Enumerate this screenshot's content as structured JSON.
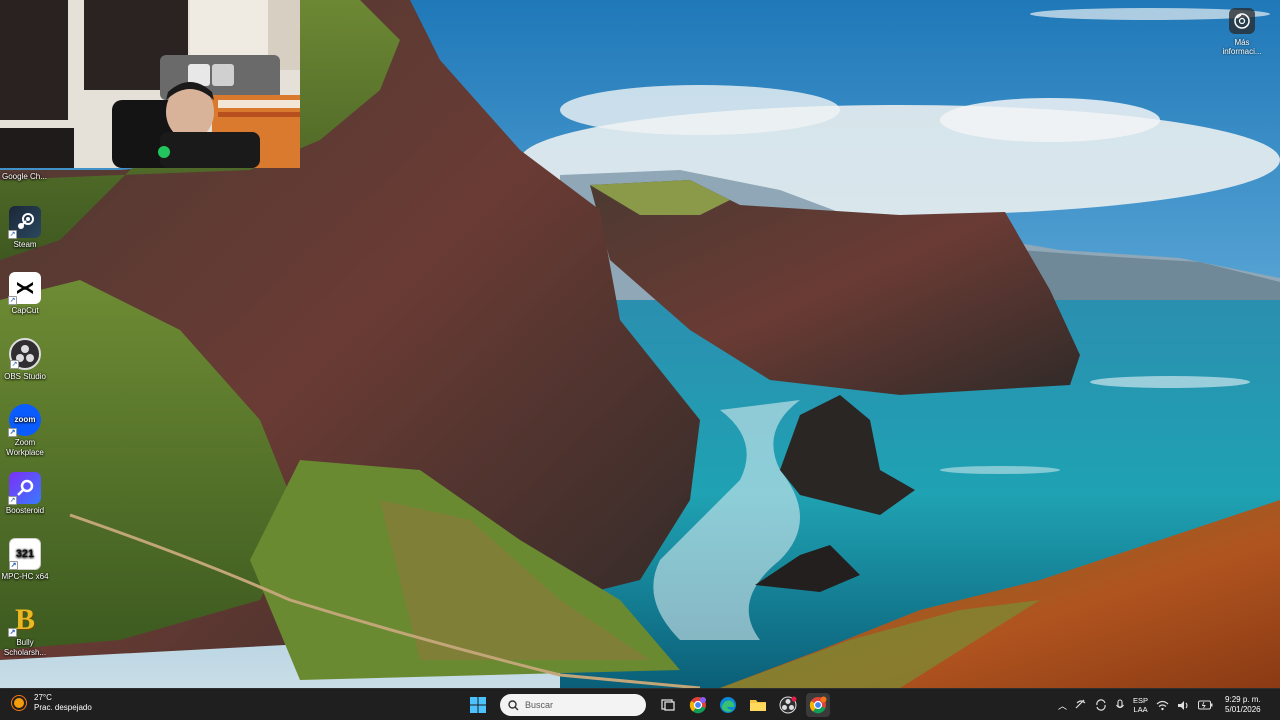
{
  "desktop": {
    "top_partial_label": "Google Ch...",
    "icons": [
      {
        "label": "Steam",
        "icon": "steam-icon"
      },
      {
        "label": "CapCut",
        "icon": "capcut-icon"
      },
      {
        "label": "OBS Studio",
        "icon": "obs-icon"
      },
      {
        "label": "Zoom Workplace",
        "icon": "zoom-icon",
        "glyph_text": "zoom"
      },
      {
        "label": "Boosteroid",
        "icon": "boosteroid-icon"
      },
      {
        "label": "MPC-HC x64",
        "icon": "mpc-hc-icon",
        "glyph_text": "321"
      },
      {
        "label": "Bully Scholarsh...",
        "icon": "bully-icon",
        "glyph_text": "B"
      }
    ],
    "info_button": {
      "label": "Más informaci...",
      "icon": "camera-info-icon"
    }
  },
  "webcam": {
    "poster_text": "",
    "description_icon": "webcam-overlay"
  },
  "taskbar": {
    "weather": {
      "temp": "27°C",
      "condition": "Prac. despejado",
      "icon": "weather-sun-icon"
    },
    "search_placeholder": "Buscar",
    "pinned": [
      {
        "name": "start-button",
        "icon": "windows-icon"
      },
      {
        "name": "task-view-button",
        "icon": "task-view-icon"
      },
      {
        "name": "chrome-profile-button",
        "icon": "chrome-icon"
      },
      {
        "name": "edge-button",
        "icon": "edge-icon"
      },
      {
        "name": "file-explorer-button",
        "icon": "folder-icon"
      },
      {
        "name": "obs-taskbar-button",
        "icon": "obs-icon"
      },
      {
        "name": "chrome-taskbar-button",
        "icon": "chrome-icon"
      }
    ],
    "tray": {
      "language": "ESP",
      "language_sub": "LAA",
      "time": "9:29 p. m.",
      "date": "5/01/2026"
    }
  },
  "colors": {
    "taskbar_bg": "#1f1f1f",
    "accent": "#0078d4"
  }
}
